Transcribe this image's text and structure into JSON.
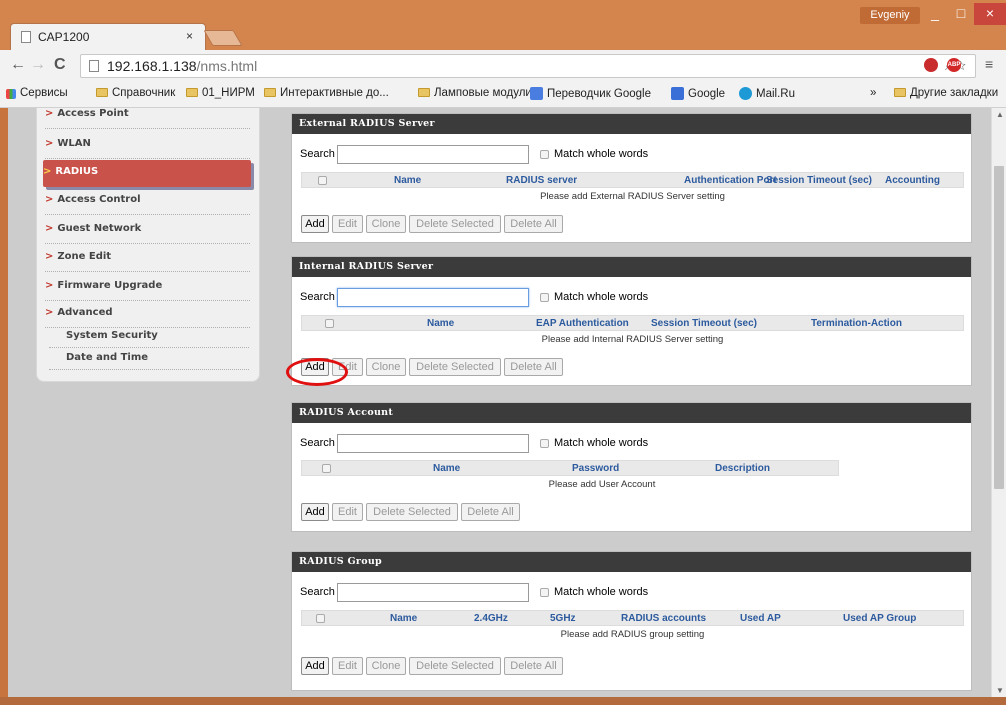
{
  "browser": {
    "tab_title": "CAP1200",
    "tab_close": "×",
    "user": "Evgeniy",
    "url_host": "192.168.1.138",
    "url_path": "/nms.html",
    "bookmarks": [
      "Сервисы",
      "Справочник",
      "01_НИРМ",
      "Интерактивные до...",
      "Ламповые модули",
      "Переводчик Google",
      "Google",
      "Mail.Ru",
      "»",
      "Другие закладки"
    ]
  },
  "sidebar": {
    "items": [
      "Access Point",
      "WLAN",
      "RADIUS",
      "Access Control",
      "Guest Network",
      "Zone Edit",
      "Firmware Upgrade",
      "Advanced"
    ],
    "arrow": ">",
    "active": "RADIUS",
    "subitems": [
      "System Security",
      "Date and Time"
    ]
  },
  "common": {
    "search_label": "Search",
    "match_label": "Match whole words",
    "add": "Add",
    "edit": "Edit",
    "clone": "Clone",
    "delete_selected": "Delete Selected",
    "delete_all": "Delete All"
  },
  "panels": {
    "external": {
      "title": "External RADIUS Server",
      "columns": [
        "Name",
        "RADIUS server",
        "Authentication Port",
        "Session Timeout (sec)",
        "Accounting"
      ],
      "empty": "Please add External RADIUS Server setting"
    },
    "internal": {
      "title": "Internal RADIUS Server",
      "columns": [
        "Name",
        "EAP Authentication",
        "Session Timeout (sec)",
        "Termination-Action"
      ],
      "empty": "Please add Internal RADIUS Server setting"
    },
    "account": {
      "title": "RADIUS Account",
      "columns": [
        "Name",
        "Password",
        "Description"
      ],
      "empty": "Please add User Account"
    },
    "group": {
      "title": "RADIUS Group",
      "columns": [
        "Name",
        "2.4GHz",
        "5GHz",
        "RADIUS accounts",
        "Used AP",
        "Used AP Group"
      ],
      "empty": "Please add RADIUS group setting"
    }
  },
  "colors": {
    "accent": "#c9524a",
    "header": "#3b3b3b",
    "column_text": "#2c5a9e",
    "annotation": "#e01010"
  }
}
